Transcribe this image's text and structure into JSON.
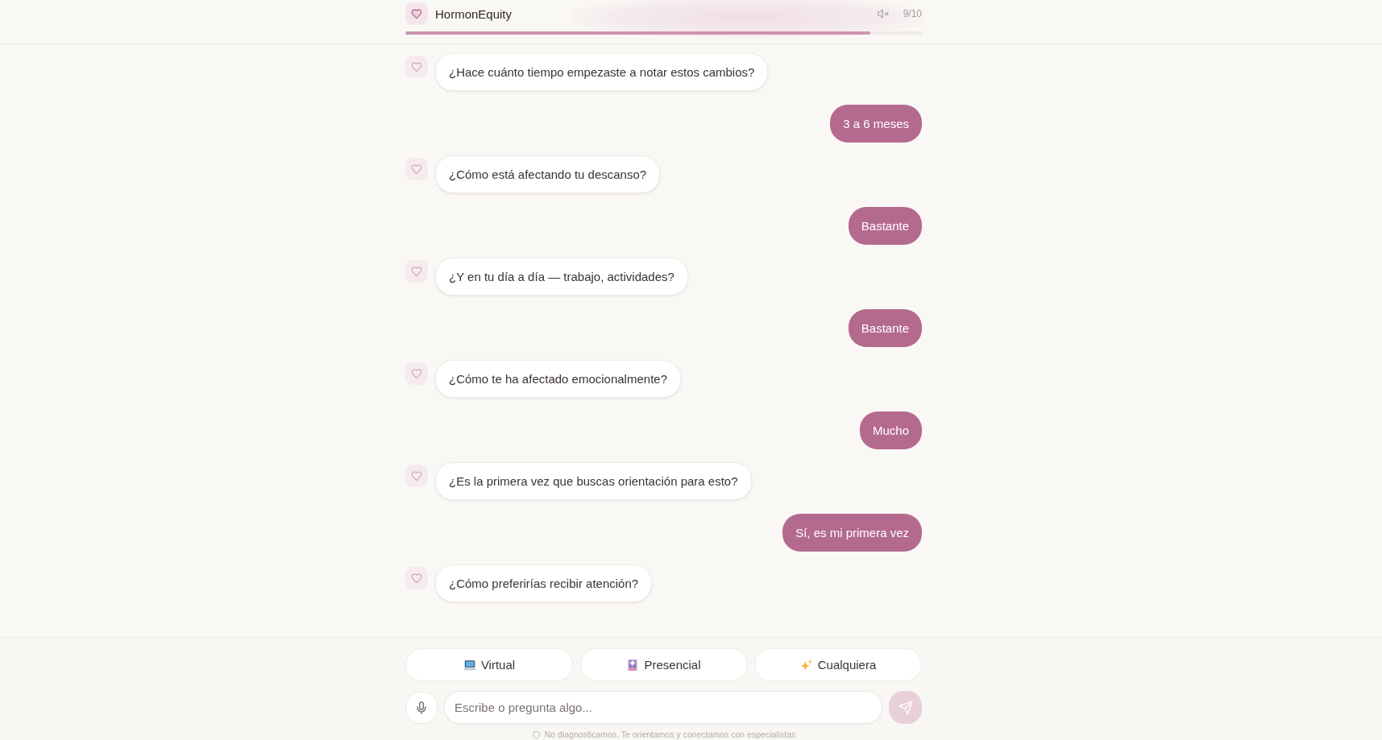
{
  "header": {
    "title": "HormonEquity",
    "sound_muted": true,
    "counter": "9/10",
    "progress": {
      "level": 0.9
    }
  },
  "messages": [
    {
      "kind": "bot",
      "text": "¿Hace cuánto tiempo empezaste a notar estos cambios?"
    },
    {
      "kind": "user",
      "text": "3 a 6 meses"
    },
    {
      "kind": "bot",
      "text": "¿Cómo está afectando tu descanso?"
    },
    {
      "kind": "user",
      "text": "Bastante"
    },
    {
      "kind": "bot",
      "text": "¿Y en tu día a día — trabajo, actividades?"
    },
    {
      "kind": "user",
      "text": "Bastante"
    },
    {
      "kind": "bot",
      "text": "¿Cómo te ha afectado emocionalmente?"
    },
    {
      "kind": "user",
      "text": "Mucho"
    },
    {
      "kind": "bot",
      "text": "¿Es la primera vez que buscas orientación para esto?"
    },
    {
      "kind": "user",
      "text": "Sí, es mi primera vez"
    },
    {
      "kind": "bot",
      "text": "¿Cómo preferirías recibir atención?"
    }
  ],
  "quick_replies": [
    "Virtual",
    "Presencial",
    "Cualquiera"
  ],
  "composer": {
    "placeholder": "Escribe o pregunta algo...",
    "send_disabled": true
  },
  "footnote": "No diagnosticamos. Te orientamos y conectamos con especialistas"
}
